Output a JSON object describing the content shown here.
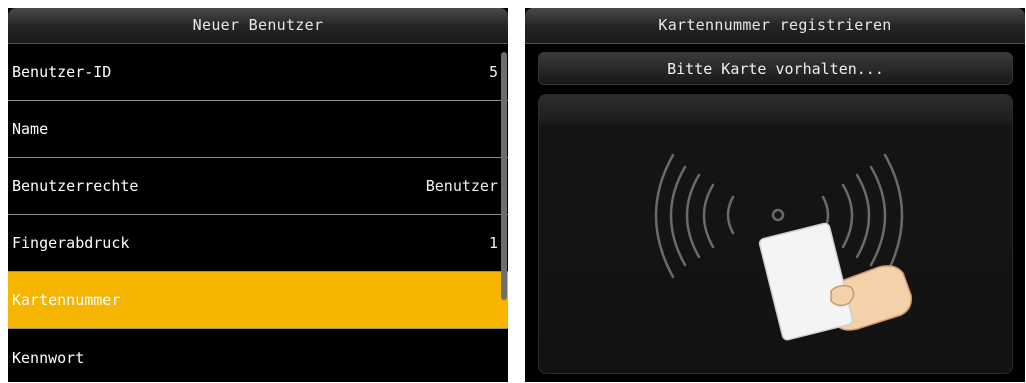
{
  "left_screen": {
    "title": "Neuer Benutzer",
    "items": [
      {
        "label": "Benutzer-ID",
        "value": "5"
      },
      {
        "label": "Name",
        "value": ""
      },
      {
        "label": "Benutzerrechte",
        "value": "Benutzer"
      },
      {
        "label": "Fingerabdruck",
        "value": "1"
      },
      {
        "label": "Kartennummer",
        "value": ""
      },
      {
        "label": "Kennwort",
        "value": ""
      }
    ],
    "selected_index": 4
  },
  "right_screen": {
    "title": "Kartennummer registrieren",
    "prompt": "Bitte Karte vorhalten...",
    "illustration_icon": "card-reader-icon"
  },
  "colors": {
    "background": "#000000",
    "highlight": "#f5b500",
    "text": "#ffffff",
    "divider": "#8c8c8c"
  }
}
